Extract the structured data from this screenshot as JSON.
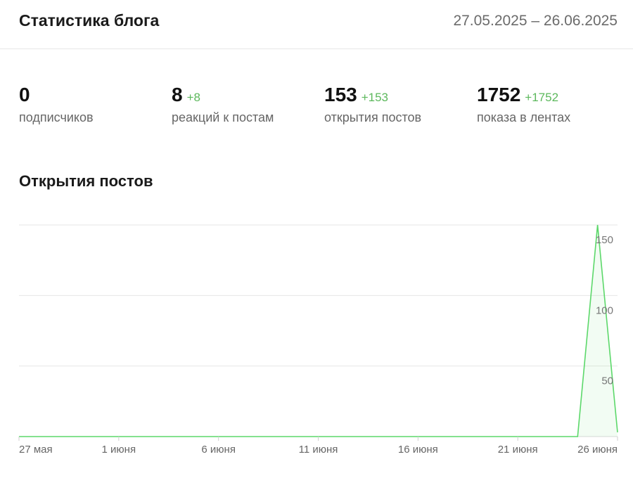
{
  "header": {
    "title": "Статистика блога",
    "date_range": "27.05.2025 – 26.06.2025"
  },
  "stats": [
    {
      "value": "0",
      "delta": "",
      "label": "подписчиков"
    },
    {
      "value": "8",
      "delta": "+8",
      "label": "реакций к постам"
    },
    {
      "value": "153",
      "delta": "+153",
      "label": "открытия постов"
    },
    {
      "value": "1752",
      "delta": "+1752",
      "label": "показа в лентах"
    }
  ],
  "section": {
    "title": "Открытия постов"
  },
  "colors": {
    "accent": "#5cd86a",
    "accent_text": "#5cb85c",
    "grid": "#e6e6e6"
  },
  "chart_data": {
    "type": "area",
    "title": "Открытия постов",
    "xlabel": "",
    "ylabel": "",
    "x_start": "2025-05-27",
    "x_end": "2025-06-26",
    "xticks": [
      "27 мая",
      "1 июня",
      "6 июня",
      "11 июня",
      "16 июня",
      "21 июня",
      "26 июня"
    ],
    "yticks": [
      50,
      100,
      150
    ],
    "ylim": [
      0,
      150
    ],
    "grid": true,
    "x": [
      "2025-05-27",
      "2025-05-28",
      "2025-05-29",
      "2025-05-30",
      "2025-05-31",
      "2025-06-01",
      "2025-06-02",
      "2025-06-03",
      "2025-06-04",
      "2025-06-05",
      "2025-06-06",
      "2025-06-07",
      "2025-06-08",
      "2025-06-09",
      "2025-06-10",
      "2025-06-11",
      "2025-06-12",
      "2025-06-13",
      "2025-06-14",
      "2025-06-15",
      "2025-06-16",
      "2025-06-17",
      "2025-06-18",
      "2025-06-19",
      "2025-06-20",
      "2025-06-21",
      "2025-06-22",
      "2025-06-23",
      "2025-06-24",
      "2025-06-25",
      "2025-06-26"
    ],
    "series": [
      {
        "values": [
          0,
          0,
          0,
          0,
          0,
          0,
          0,
          0,
          0,
          0,
          0,
          0,
          0,
          0,
          0,
          0,
          0,
          0,
          0,
          0,
          0,
          0,
          0,
          0,
          0,
          0,
          0,
          0,
          0,
          150,
          3
        ]
      }
    ]
  }
}
